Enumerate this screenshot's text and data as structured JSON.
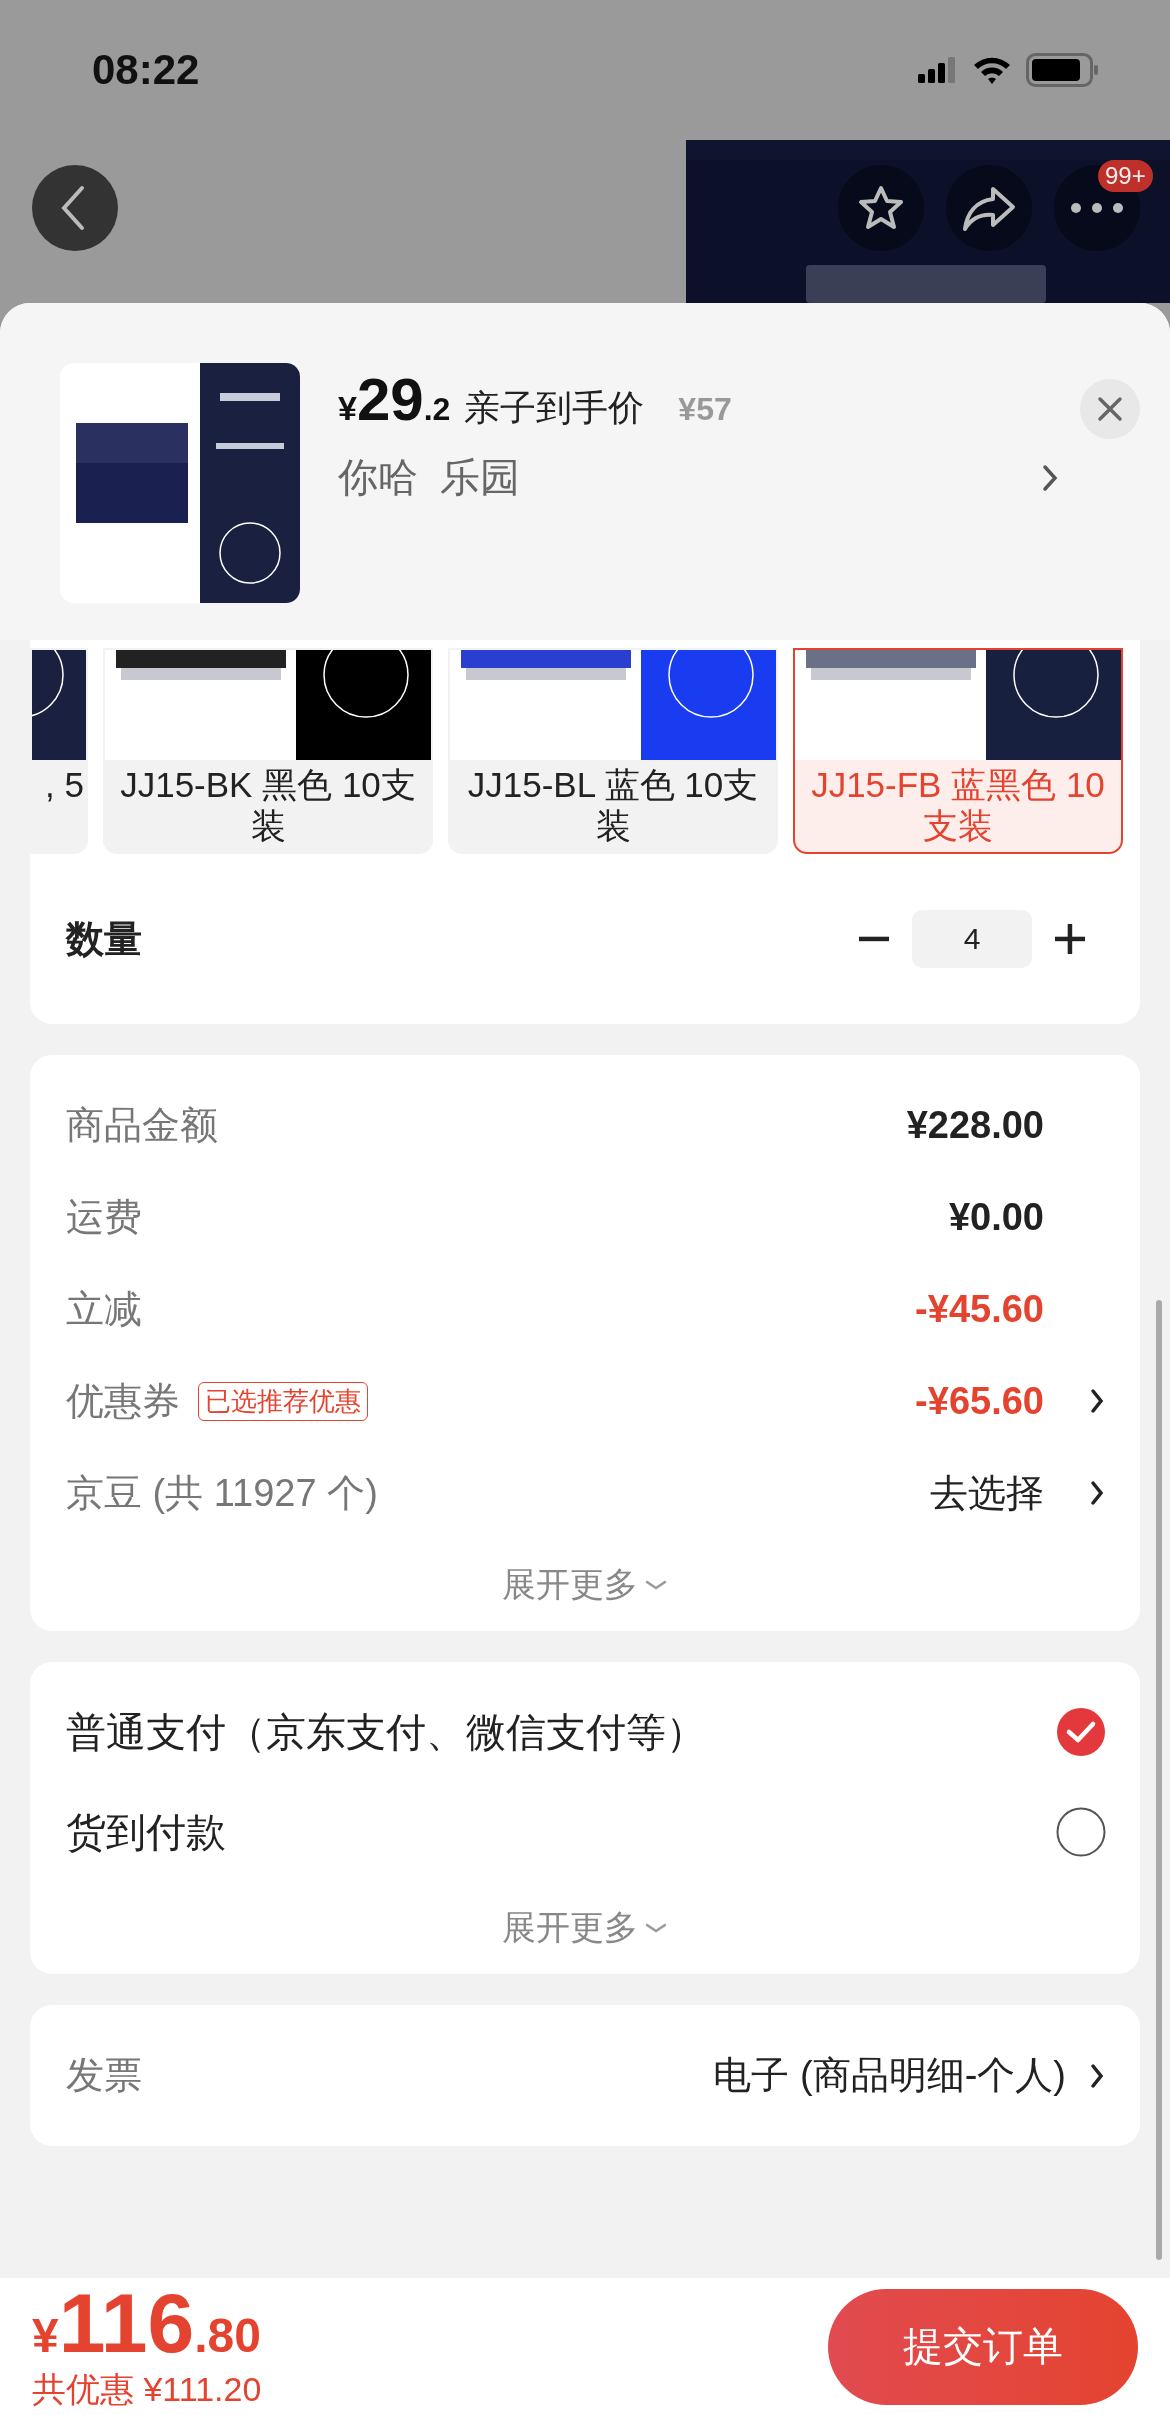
{
  "status_bar": {
    "time": "08:22"
  },
  "nav": {
    "badge": "99+"
  },
  "product": {
    "currency": "¥",
    "price_int": "29",
    "price_dec": ".2",
    "price_label": "亲子到手价",
    "original_price": "¥57",
    "name": "你哈  乐园"
  },
  "variants": [
    {
      "label": ", 5",
      "selected": false
    },
    {
      "label": "JJ15-BK 黑色 10支装",
      "selected": false
    },
    {
      "label": "JJ15-BL 蓝色 10支装",
      "selected": false
    },
    {
      "label": "JJ15-FB 蓝黑色 10支装",
      "selected": true
    }
  ],
  "quantity": {
    "label": "数量",
    "value": "4"
  },
  "summary": {
    "rows": [
      {
        "label": "商品金额",
        "value": "¥228.00",
        "kind": "plain"
      },
      {
        "label": "运费",
        "value": "¥0.00",
        "kind": "plain"
      },
      {
        "label": "立减",
        "value": "-¥45.60",
        "kind": "discount"
      },
      {
        "label": "优惠券",
        "tag": "已选推荐优惠",
        "value": "-¥65.60",
        "kind": "discount",
        "chevron": true
      },
      {
        "label": "京豆 (共 11927 个)",
        "value": "去选择",
        "kind": "action",
        "chevron": true
      }
    ],
    "expand": "展开更多"
  },
  "payment": {
    "options": [
      {
        "label": "普通支付（京东支付、微信支付等）",
        "selected": true
      },
      {
        "label": "货到付款",
        "selected": false
      }
    ],
    "expand": "展开更多"
  },
  "invoice": {
    "label": "发票",
    "value": "电子 (商品明细-个人)"
  },
  "footer": {
    "currency": "¥",
    "total_int": "116",
    "total_dec": ".80",
    "savings": "共优惠 ¥111.20",
    "submit": "提交订单"
  }
}
